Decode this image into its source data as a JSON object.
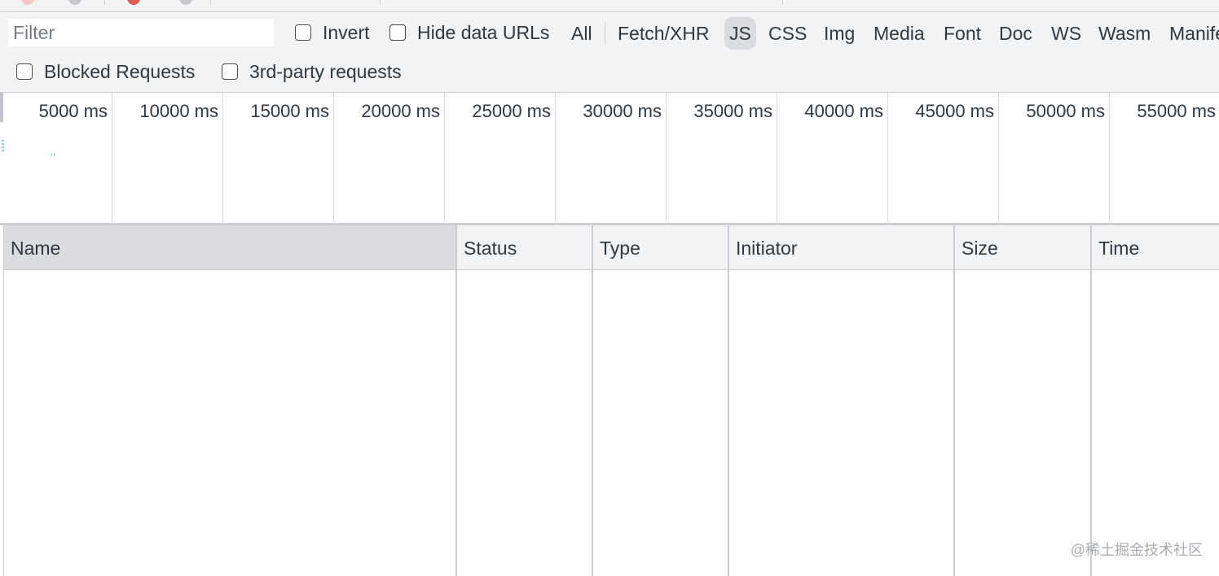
{
  "filter": {
    "placeholder": "Filter",
    "value": ""
  },
  "options": {
    "invert_label": "Invert",
    "hide_data_urls_label": "Hide data URLs",
    "blocked_requests_label": "Blocked Requests",
    "third_party_label": "3rd-party requests"
  },
  "type_filters": {
    "all": "All",
    "fetch_xhr": "Fetch/XHR",
    "js": "JS",
    "css": "CSS",
    "img": "Img",
    "media": "Media",
    "font": "Font",
    "doc": "Doc",
    "ws": "WS",
    "wasm": "Wasm",
    "manifest": "Manife",
    "active": "JS"
  },
  "overview": {
    "ticks": [
      "5000 ms",
      "10000 ms",
      "15000 ms",
      "20000 ms",
      "25000 ms",
      "30000 ms",
      "35000 ms",
      "40000 ms",
      "45000 ms",
      "50000 ms",
      "55000 ms"
    ]
  },
  "table": {
    "columns": [
      "Name",
      "Status",
      "Type",
      "Initiator",
      "Size",
      "Time"
    ],
    "sorted_column": "Name",
    "rows": []
  },
  "watermark": "@稀土掘金技术社区"
}
